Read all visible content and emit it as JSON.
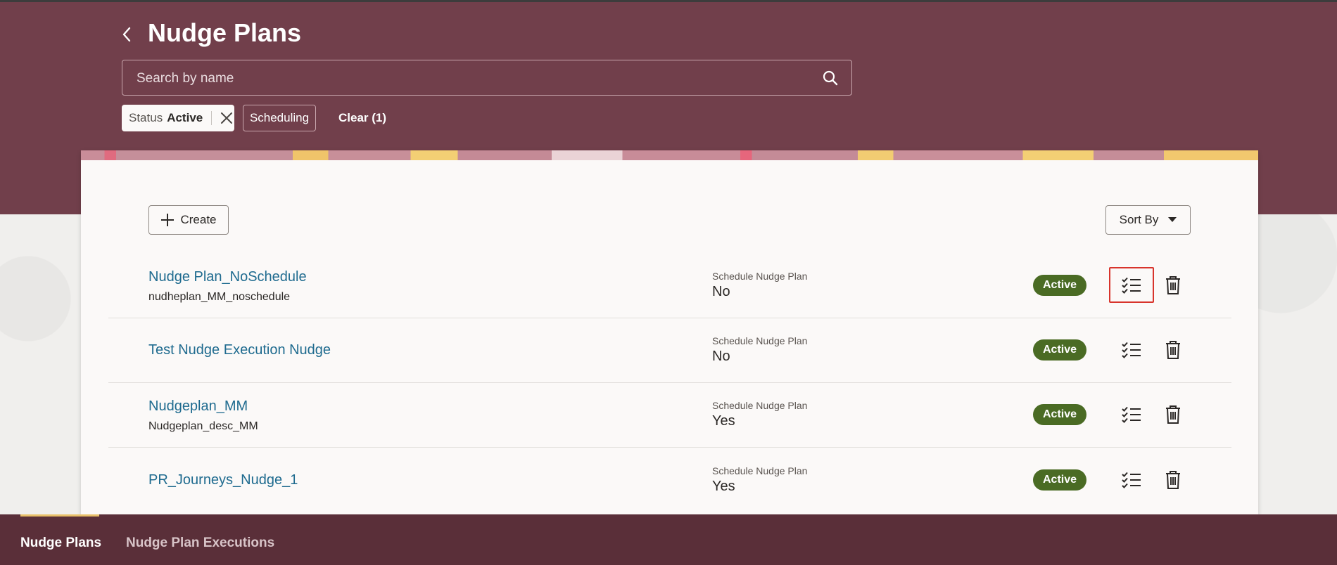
{
  "page": {
    "title": "Nudge Plans"
  },
  "search": {
    "placeholder": "Search by name",
    "value": ""
  },
  "filters": {
    "status_key": "Status",
    "status_value": "Active",
    "scheduling_label": "Scheduling",
    "clear_label": "Clear (1)"
  },
  "toolbar": {
    "create_label": "Create",
    "sort_label": "Sort By"
  },
  "plans": [
    {
      "name": "Nudge Plan_NoSchedule",
      "description": "nudheplan_MM_noschedule",
      "schedule_label": "Schedule Nudge Plan",
      "schedule_value": "No",
      "status": "Active"
    },
    {
      "name": "Test Nudge Execution Nudge",
      "description": "",
      "schedule_label": "Schedule Nudge Plan",
      "schedule_value": "No",
      "status": "Active"
    },
    {
      "name": "Nudgeplan_MM",
      "description": "Nudgeplan_desc_MM",
      "schedule_label": "Schedule Nudge Plan",
      "schedule_value": "Yes",
      "status": "Active"
    },
    {
      "name": "PR_Journeys_Nudge_1",
      "description": "",
      "schedule_label": "Schedule Nudge Plan",
      "schedule_value": "Yes",
      "status": "Active"
    }
  ],
  "bottom_nav": {
    "tabs": [
      {
        "label": "Nudge Plans",
        "active": true
      },
      {
        "label": "Nudge Plan Executions",
        "active": false
      }
    ]
  },
  "colors": {
    "header_bg": "#713f4b",
    "bottom_nav_bg": "#5a2f39",
    "link": "#1f6b8f",
    "status_active": "#4a6b24",
    "focus_outline": "#d8342c",
    "nav_indicator": "#e9c16a"
  },
  "icons": {
    "back": "chevron-left-icon",
    "search": "search-icon",
    "chip_close": "close-icon",
    "create": "plus-icon",
    "sort": "caret-down-icon",
    "execute": "checklist-icon",
    "delete": "trash-icon"
  }
}
